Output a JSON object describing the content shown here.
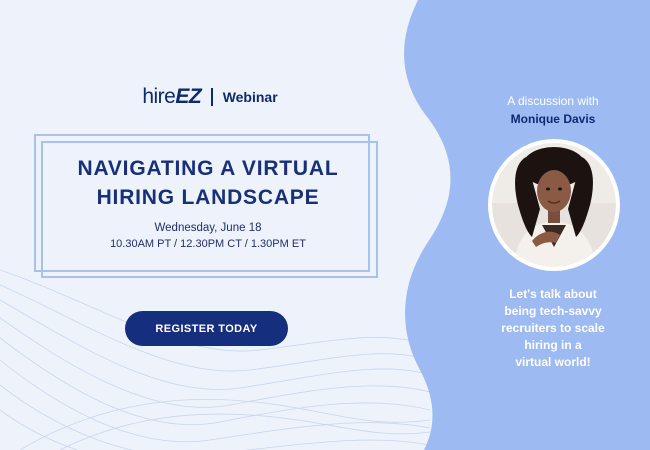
{
  "brand": {
    "logo_prefix": "hire",
    "logo_suffix": "EZ",
    "label": "Webinar"
  },
  "event": {
    "title": "NAVIGATING A VIRTUAL HIRING LANDSCAPE",
    "date": "Wednesday, June 18",
    "times": "10.30AM PT / 12.30PM CT / 1.30PM ET"
  },
  "cta": {
    "label": "REGISTER TODAY"
  },
  "speaker": {
    "intro": "A discussion with",
    "name": "Monique Davis",
    "tagline": "Let's talk about\nbeing tech-savvy\nrecruiters to scale\nhiring in a\nvirtual world!"
  },
  "colors": {
    "background": "#eef2fa",
    "panel": "#9dbaf2",
    "accent_dark": "#152e7e",
    "frame": "#a8c0ec"
  },
  "icons": {
    "speaker_photo": "person-portrait"
  }
}
